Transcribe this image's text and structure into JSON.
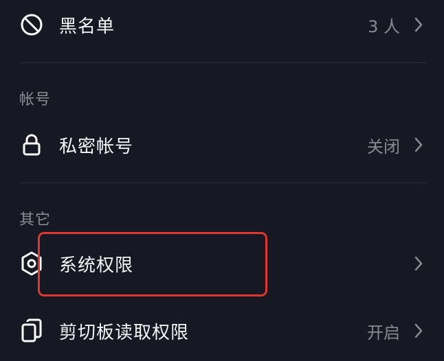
{
  "rows": {
    "blacklist": {
      "label": "黑名单",
      "value": "3 人",
      "icon": "block-icon"
    },
    "private_account": {
      "label": "私密帐号",
      "value": "关闭",
      "icon": "lock-icon"
    },
    "system_permissions": {
      "label": "系统权限",
      "value": "",
      "icon": "settings-hexagon-icon"
    },
    "clipboard_permission": {
      "label": "剪切板读取权限",
      "value": "开启",
      "icon": "clipboard-icon"
    }
  },
  "sections": {
    "account": "帐号",
    "other": "其它"
  },
  "colors": {
    "background": "#161823",
    "highlight": "#e2372e",
    "secondary_text": "#8a8b91",
    "divider": "#2b2d38"
  }
}
